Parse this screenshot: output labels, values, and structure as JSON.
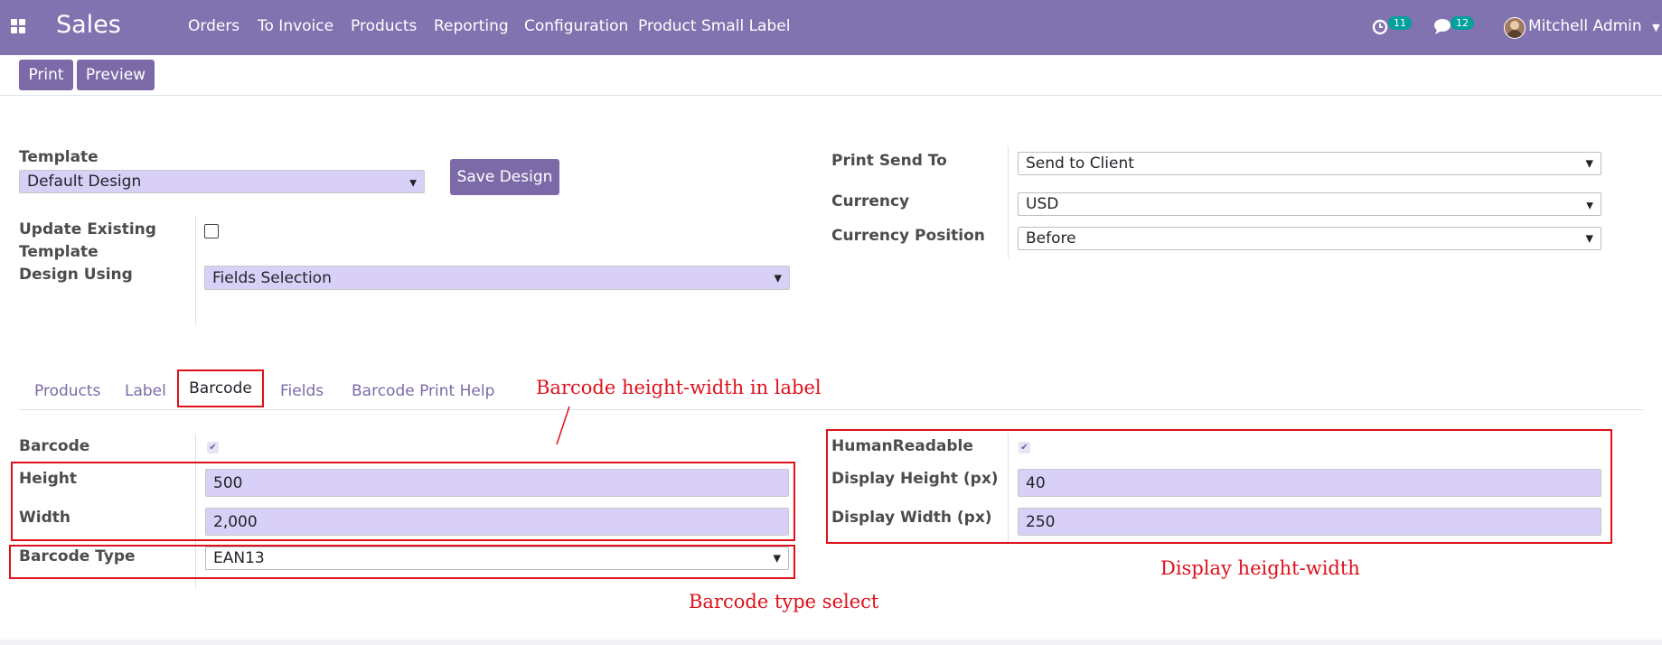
{
  "navbar": {
    "app_name": "Sales",
    "menu": [
      "Orders",
      "To Invoice",
      "Products",
      "Reporting",
      "Configuration",
      "Product Small Label"
    ],
    "activity_count": "11",
    "message_count": "12",
    "user_name": "Mitchell Admin",
    "bg_color": "#8073b0"
  },
  "toolbar": {
    "print_label": "Print",
    "preview_label": "Preview"
  },
  "form": {
    "template_label": "Template",
    "template_value": "Default Design",
    "save_design_label": "Save Design",
    "update_existing_label_1": "Update Existing",
    "update_existing_label_2": "Template",
    "design_using_label": "Design Using",
    "design_using_value": "Fields Selection",
    "print_send_to_label": "Print Send To",
    "print_send_to_value": "Send to Client",
    "currency_label": "Currency",
    "currency_value": "USD",
    "currency_position_label": "Currency Position",
    "currency_position_value": "Before"
  },
  "tabs": [
    "Products",
    "Label",
    "Barcode",
    "Fields",
    "Barcode Print Help"
  ],
  "active_tab": "Barcode",
  "barcode": {
    "barcode_label": "Barcode",
    "height_label": "Height",
    "height_value": "500",
    "width_label": "Width",
    "width_value": "2,000",
    "barcode_type_label": "Barcode Type",
    "barcode_type_value": "EAN13",
    "human_readable_label": "HumanReadable",
    "display_height_label": "Display Height (px)",
    "display_height_value": "40",
    "display_width_label": "Display Width (px)",
    "display_width_value": "250"
  },
  "annotations": {
    "barcode_hw": "Barcode height-width in label",
    "display_hw": "Display height-width",
    "barcode_type": "Barcode type select",
    "color": "#e0101b"
  }
}
